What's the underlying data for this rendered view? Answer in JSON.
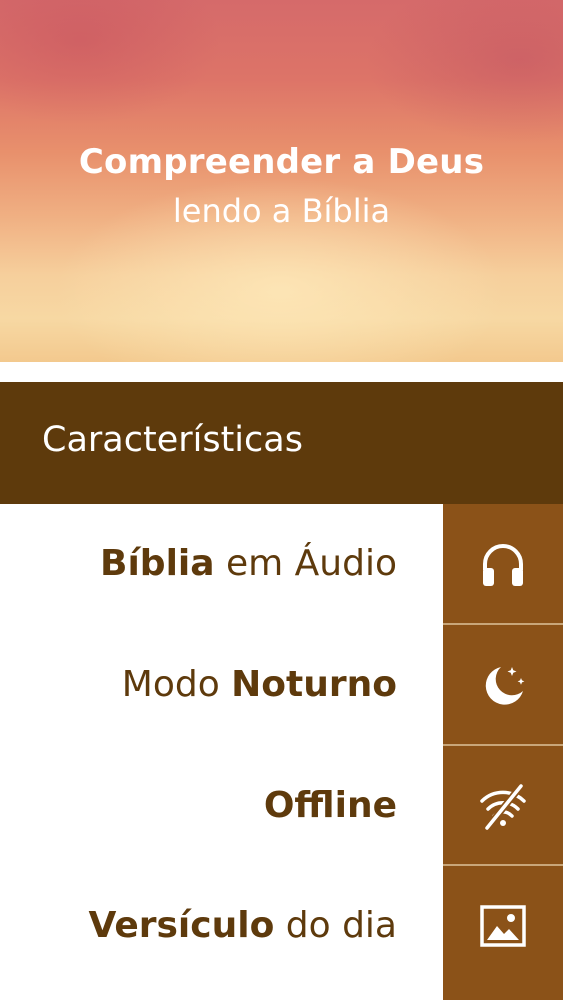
{
  "hero": {
    "title": "Compreender a Deus",
    "subtitle": "lendo a Bíblia"
  },
  "section": {
    "title": "Características"
  },
  "features": [
    {
      "bold": "Bíblia",
      "normal": " em Áudio",
      "icon": "headphones-icon"
    },
    {
      "normal": "Modo ",
      "bold": "Noturno",
      "icon": "moon-stars-icon"
    },
    {
      "bold": "Offline",
      "icon": "wifi-off-icon"
    },
    {
      "bold": "Versículo",
      "normal": " do dia",
      "icon": "image-icon"
    }
  ],
  "colors": {
    "header_brown": "#5e3a0c",
    "tile_brown": "#8b5218",
    "text_brown": "#5e3a0c"
  }
}
